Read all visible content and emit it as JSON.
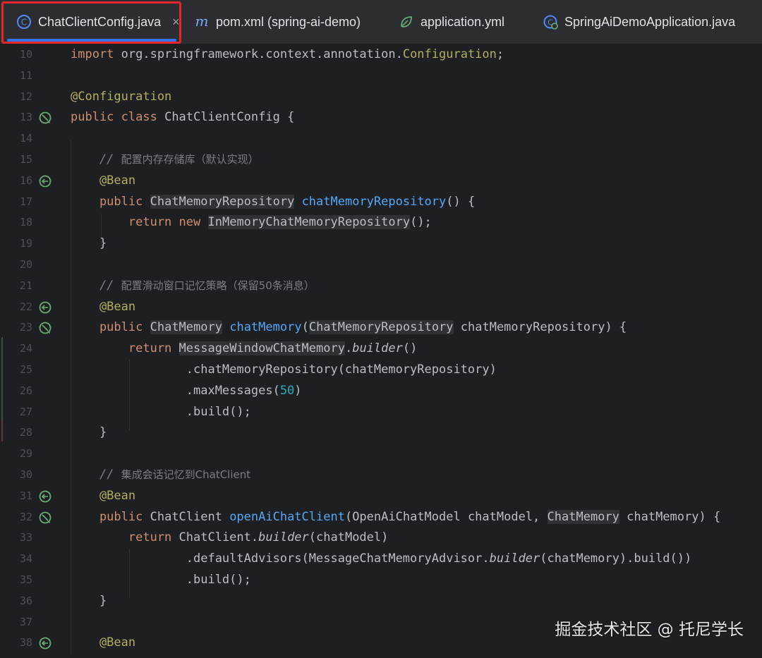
{
  "tabs": [
    {
      "label": "ChatClientConfig.java",
      "icon": "java-class-icon",
      "active": true,
      "close": "×"
    },
    {
      "label": "pom.xml (spring-ai-demo)",
      "icon": "maven-icon",
      "active": false
    },
    {
      "label": "application.yml",
      "icon": "spring-leaf-icon",
      "active": false
    },
    {
      "label": "SpringAiDemoApplication.java",
      "icon": "spring-class-icon",
      "active": false
    }
  ],
  "colors": {
    "background": "#1e1f22",
    "tabbar": "#2b2d30",
    "accent": "#3574f0",
    "highlight_border": "#e5252a",
    "keyword": "#cf8e6d",
    "annotation": "#b3ae60",
    "method": "#56a8f5",
    "number": "#2aacb8",
    "comment": "#7a7e85"
  },
  "editor": {
    "lines": [
      {
        "n": "10"
      },
      {
        "n": "11"
      },
      {
        "n": "12"
      },
      {
        "n": "13"
      },
      {
        "n": "14"
      },
      {
        "n": "15"
      },
      {
        "n": "16"
      },
      {
        "n": "17"
      },
      {
        "n": "18"
      },
      {
        "n": "19"
      },
      {
        "n": "20"
      },
      {
        "n": "21"
      },
      {
        "n": "22"
      },
      {
        "n": "23"
      },
      {
        "n": "24"
      },
      {
        "n": "25"
      },
      {
        "n": "26"
      },
      {
        "n": "27"
      },
      {
        "n": "28"
      },
      {
        "n": "29"
      },
      {
        "n": "30"
      },
      {
        "n": "31"
      },
      {
        "n": "32"
      },
      {
        "n": "33"
      },
      {
        "n": "34"
      },
      {
        "n": "35"
      },
      {
        "n": "36"
      },
      {
        "n": "37"
      },
      {
        "n": "38"
      }
    ],
    "code": {
      "l10_import": "import",
      "l10_pkg": " org.springframework.context.annotation.",
      "l10_cls": "Configuration",
      "l10_end": ";",
      "l12_ann": "@Configuration",
      "l13_public": "public",
      "l13_class": " class",
      "l13_rest": " ChatClientConfig {",
      "l15_slashes": "    // ",
      "l15_text": "配置内存存储库（默认实现）",
      "l16_ann": "    @Bean",
      "l17_public": "    public",
      "l17_type": "ChatMemoryRepository",
      "l17_method": "chatMemoryRepository",
      "l17_end": "() {",
      "l18_return": "        return",
      "l18_new": " new",
      "l18_type": "InMemoryChatMemoryRepository",
      "l18_end": "();",
      "l19": "    }",
      "l21_slashes": "    // ",
      "l21_text": "配置滑动窗口记忆策略（保留50条消息）",
      "l22_ann": "    @Bean",
      "l23_public": "    public",
      "l23_type": "ChatMemory",
      "l23_method": "chatMemory",
      "l23_paren": "(",
      "l23_ptype": "ChatMemoryRepository",
      "l23_end": " chatMemoryRepository) {",
      "l24_return": "        return",
      "l24_type": "MessageWindowChatMemory",
      "l24_dot": ".",
      "l24_builder": "builder",
      "l24_end": "()",
      "l25": "                .chatMemoryRepository(chatMemoryRepository)",
      "l26_start": "                .maxMessages(",
      "l26_num": "50",
      "l26_end": ")",
      "l27": "                .build();",
      "l28": "    }",
      "l30_slashes": "    // ",
      "l30_text": "集成会话记忆到ChatClient",
      "l31_ann": "    @Bean",
      "l32_public": "    public",
      "l32_type": " ChatClient ",
      "l32_method": "openAiChatClient",
      "l32_mid": "(OpenAiChatModel chatModel, ",
      "l32_ptype": "ChatMemory",
      "l32_end": " chatMemory) {",
      "l33_return": "        return",
      "l33_mid": " ChatClient.",
      "l33_builder": "builder",
      "l33_end": "(chatModel)",
      "l34_start": "                .defaultAdvisors(MessageChatMemoryAdvisor.",
      "l34_builder": "builder",
      "l34_end": "(chatMemory).build())",
      "l35": "                .build();",
      "l36": "    }",
      "l38_ann": "    @Bean"
    }
  },
  "watermark": "掘金技术社区 @ 托尼学长"
}
